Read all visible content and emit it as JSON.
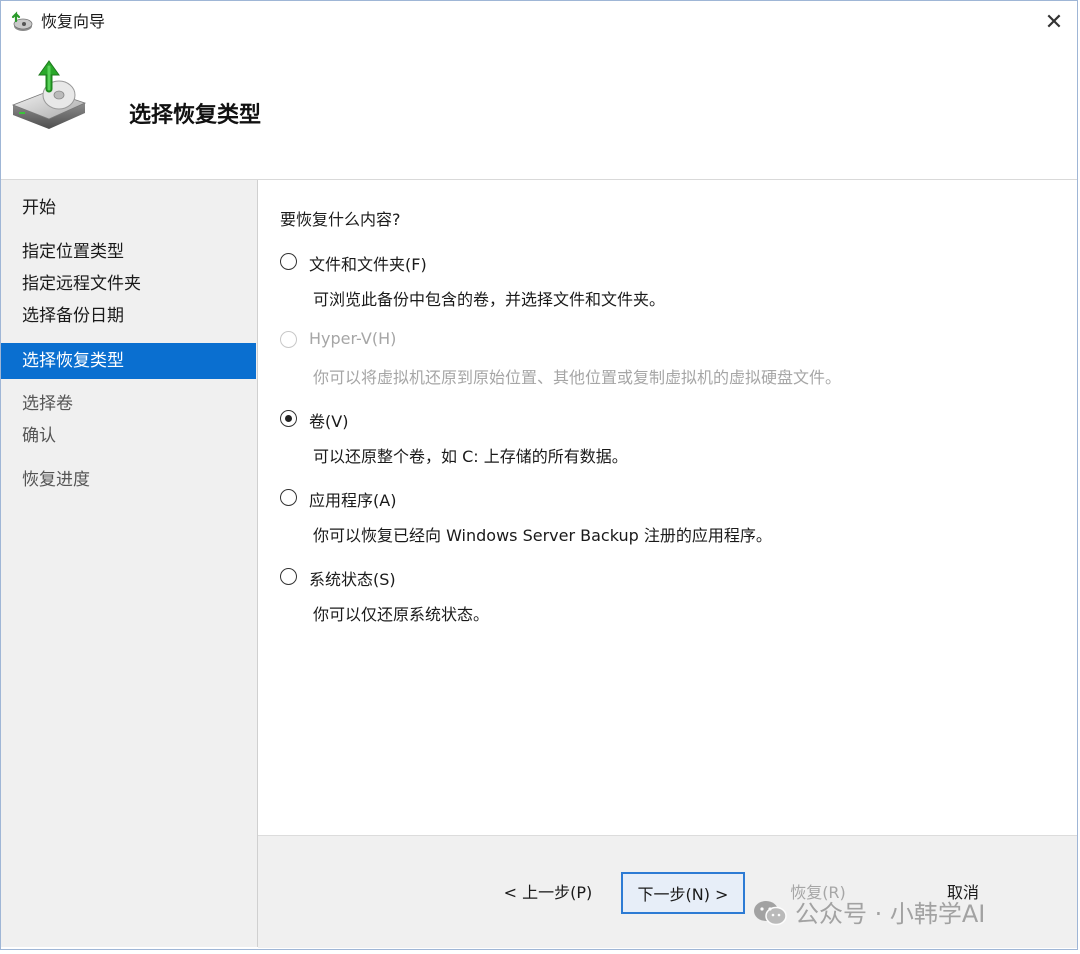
{
  "window": {
    "title": "恢复向导"
  },
  "header": {
    "title": "选择恢复类型"
  },
  "nav": {
    "items": [
      {
        "label": "开始",
        "state": "done"
      },
      {
        "label": "指定位置类型",
        "state": "done"
      },
      {
        "label": "指定远程文件夹",
        "state": "done"
      },
      {
        "label": "选择备份日期",
        "state": "done"
      },
      {
        "label": "选择恢复类型",
        "state": "active"
      },
      {
        "label": "选择卷",
        "state": "pending"
      },
      {
        "label": "确认",
        "state": "pending"
      },
      {
        "label": "恢复进度",
        "state": "pending"
      }
    ]
  },
  "main": {
    "question": "要恢复什么内容?",
    "options": [
      {
        "label": "文件和文件夹(F)",
        "description": "可浏览此备份中包含的卷，并选择文件和文件夹。",
        "checked": false,
        "disabled": false
      },
      {
        "label": "Hyper-V(H)",
        "description": "你可以将虚拟机还原到原始位置、其他位置或复制虚拟机的虚拟硬盘文件。",
        "checked": false,
        "disabled": true
      },
      {
        "label": "卷(V)",
        "description": "可以还原整个卷，如 C: 上存储的所有数据。",
        "checked": true,
        "disabled": false
      },
      {
        "label": "应用程序(A)",
        "description": "你可以恢复已经向 Windows Server Backup 注册的应用程序。",
        "checked": false,
        "disabled": false
      },
      {
        "label": "系统状态(S)",
        "description": "你可以仅还原系统状态。",
        "checked": false,
        "disabled": false
      }
    ]
  },
  "footer": {
    "prev_label": "< 上一步(P)",
    "next_label": "下一步(N) >",
    "restore_label": "恢复(R)",
    "cancel_label": "取消"
  },
  "watermark": {
    "text": "公众号 · 小韩学AI"
  },
  "icons": {
    "title": "restore-wizard-icon",
    "header": "backup-disk-restore-icon",
    "close": "close-icon",
    "watermark": "wechat-icon"
  },
  "colors": {
    "accent": "#0a6fd0",
    "nav_background": "#f0f0f0",
    "disabled_text": "#a6a6a6",
    "default_button_border": "#2d7bd4"
  }
}
